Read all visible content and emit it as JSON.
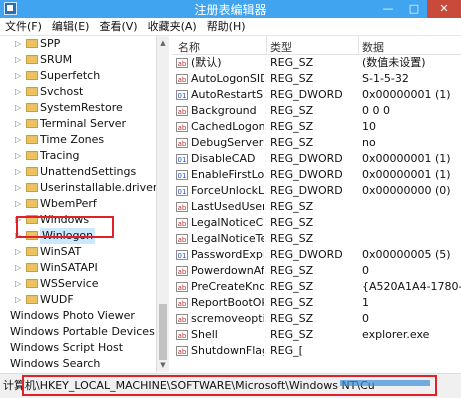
{
  "window": {
    "title": "注册表编辑器"
  },
  "menu": [
    "文件(F)",
    "编辑(E)",
    "查看(V)",
    "收藏夹(A)",
    "帮助(H)"
  ],
  "tree": {
    "items": [
      {
        "label": "SPP"
      },
      {
        "label": "SRUM"
      },
      {
        "label": "Superfetch"
      },
      {
        "label": "Svchost"
      },
      {
        "label": "SystemRestore"
      },
      {
        "label": "Terminal Server"
      },
      {
        "label": "Time Zones"
      },
      {
        "label": "Tracing"
      },
      {
        "label": "UnattendSettings"
      },
      {
        "label": "Userinstallable.drivers"
      },
      {
        "label": "WbemPerf"
      },
      {
        "label": "Windows"
      },
      {
        "label": "Winlogon",
        "selected": true
      },
      {
        "label": "WinSAT"
      },
      {
        "label": "WinSATAPI"
      },
      {
        "label": "WSService"
      },
      {
        "label": "WUDF"
      }
    ],
    "root_items": [
      {
        "label": "Windows Photo Viewer"
      },
      {
        "label": "Windows Portable Devices"
      },
      {
        "label": "Windows Script Host"
      },
      {
        "label": "Windows Search"
      }
    ]
  },
  "list": {
    "columns": {
      "name": "名称",
      "type": "类型",
      "data": "数据"
    },
    "rows": [
      {
        "icon": "string-value-icon",
        "name": "(默认)",
        "type": "REG_SZ",
        "data": "(数值未设置)"
      },
      {
        "icon": "string-value-icon",
        "name": "AutoLogonSID",
        "type": "REG_SZ",
        "data": "S-1-5-32"
      },
      {
        "icon": "dword-value-icon",
        "name": "AutoRestartShell",
        "type": "REG_DWORD",
        "data": "0x00000001 (1)"
      },
      {
        "icon": "string-value-icon",
        "name": "Background",
        "type": "REG_SZ",
        "data": "0 0 0"
      },
      {
        "icon": "string-value-icon",
        "name": "CachedLogons...",
        "type": "REG_SZ",
        "data": "10"
      },
      {
        "icon": "string-value-icon",
        "name": "DebugServerC...",
        "type": "REG_SZ",
        "data": "no"
      },
      {
        "icon": "dword-value-icon",
        "name": "DisableCAD",
        "type": "REG_DWORD",
        "data": "0x00000001 (1)"
      },
      {
        "icon": "dword-value-icon",
        "name": "EnableFirstLog...",
        "type": "REG_DWORD",
        "data": "0x00000001 (1)"
      },
      {
        "icon": "dword-value-icon",
        "name": "ForceUnlockLo...",
        "type": "REG_DWORD",
        "data": "0x00000000 (0)"
      },
      {
        "icon": "string-value-icon",
        "name": "LastUsedUsern...",
        "type": "REG_SZ",
        "data": ""
      },
      {
        "icon": "string-value-icon",
        "name": "LegalNoticeCa...",
        "type": "REG_SZ",
        "data": ""
      },
      {
        "icon": "string-value-icon",
        "name": "LegalNoticeText",
        "type": "REG_SZ",
        "data": ""
      },
      {
        "icon": "dword-value-icon",
        "name": "PasswordExpir...",
        "type": "REG_DWORD",
        "data": "0x00000005 (5)"
      },
      {
        "icon": "string-value-icon",
        "name": "PowerdownAft...",
        "type": "REG_SZ",
        "data": "0"
      },
      {
        "icon": "string-value-icon",
        "name": "PreCreateKno...",
        "type": "REG_SZ",
        "data": "{A520A1A4-1780-4FF"
      },
      {
        "icon": "string-value-icon",
        "name": "ReportBootOk",
        "type": "REG_SZ",
        "data": "1"
      },
      {
        "icon": "string-value-icon",
        "name": "scremoveoption",
        "type": "REG_SZ",
        "data": "0"
      },
      {
        "icon": "string-value-icon",
        "name": "Shell",
        "type": "REG_SZ",
        "data": "explorer.exe"
      },
      {
        "icon": "string-value-icon",
        "name": "ShutdownFlags",
        "type": "REG_[",
        "data": ""
      }
    ]
  },
  "status": {
    "path": "计算机\\HKEY_LOCAL_MACHINE\\SOFTWARE\\Microsoft\\Windows NT\\Cu"
  }
}
